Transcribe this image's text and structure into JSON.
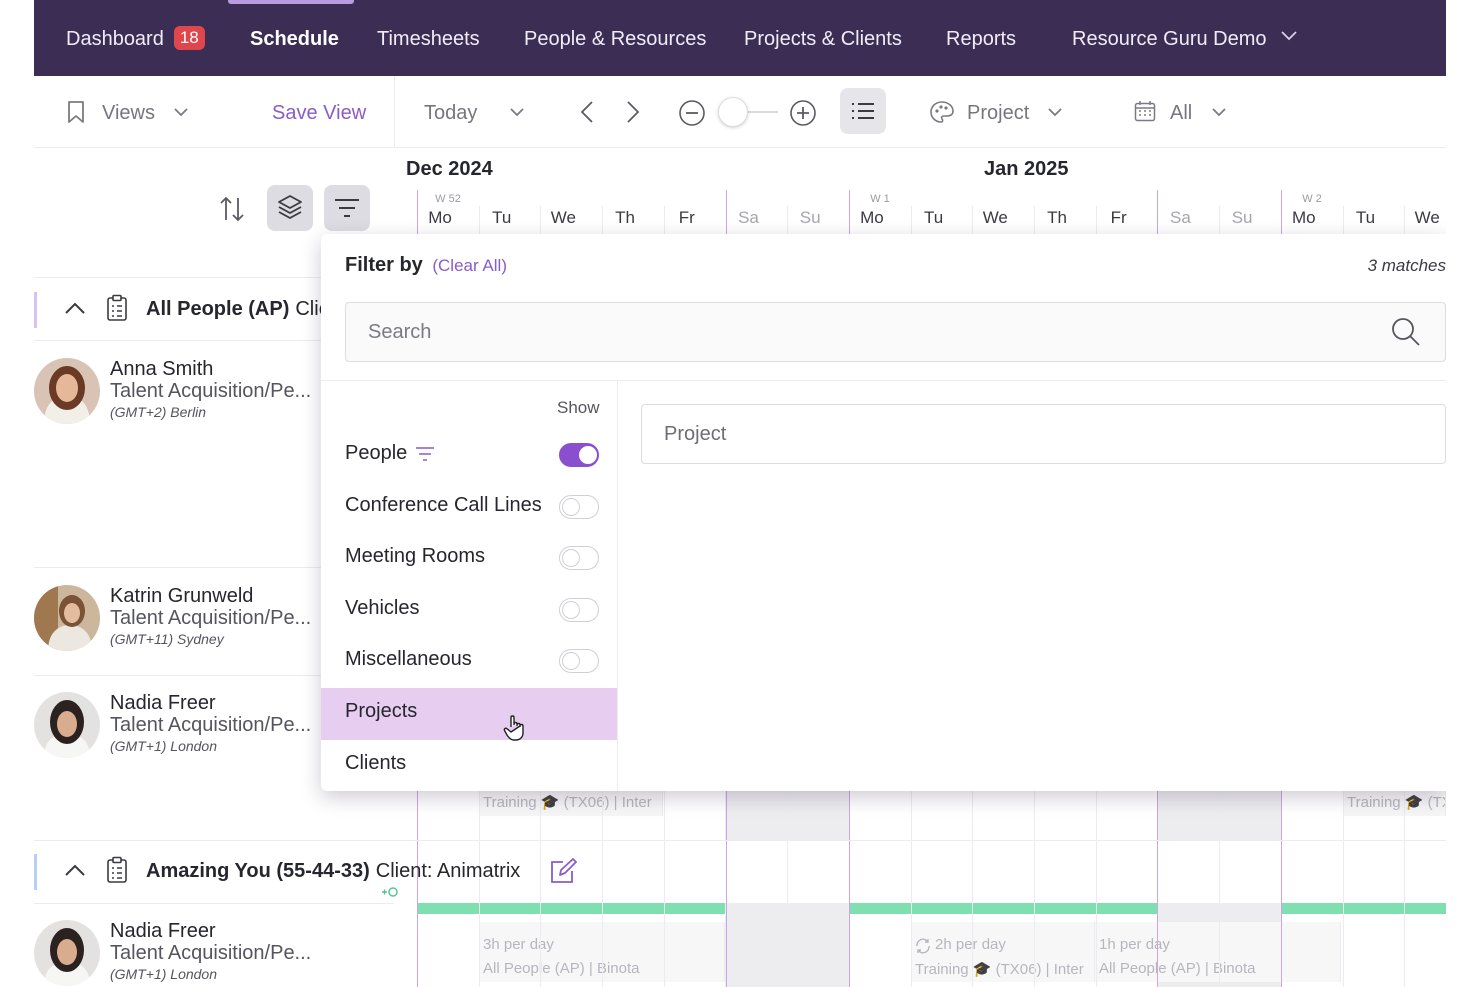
{
  "nav": {
    "items": [
      {
        "label": "Dashboard",
        "badge": "18"
      },
      {
        "label": "Schedule"
      },
      {
        "label": "Timesheets"
      },
      {
        "label": "People & Resources"
      },
      {
        "label": "Projects & Clients"
      },
      {
        "label": "Reports"
      },
      {
        "label": "Resource Guru Demo"
      }
    ],
    "active": "Schedule"
  },
  "toolbar": {
    "views_label": "Views",
    "save_view_label": "Save View",
    "today_label": "Today",
    "color_by_label": "Project",
    "date_filter_label": "All"
  },
  "calendar": {
    "months": [
      "Dec 2024",
      "Jan 2025"
    ],
    "weeks": [
      "W 52",
      "W 1",
      "W 2"
    ],
    "days": [
      "Mo",
      "Tu",
      "We",
      "Th",
      "Fr",
      "Sa",
      "Su",
      "Mo",
      "Tu",
      "We",
      "Th",
      "Fr",
      "Sa",
      "Su",
      "Mo",
      "Tu",
      "We"
    ]
  },
  "groups": [
    {
      "title": "All People (AP)",
      "client": "Clie"
    },
    {
      "title": "Amazing You (55-44-33)",
      "client": "Client: Animatrix"
    }
  ],
  "people": [
    {
      "name": "Anna Smith",
      "role": "Talent Acquisition/Pe...",
      "tz": "(GMT+2) Berlin"
    },
    {
      "name": "Katrin Grunweld",
      "role": "Talent Acquisition/Pe...",
      "tz": "(GMT+11) Sydney"
    },
    {
      "name": "Nadia Freer",
      "role": "Talent Acquisition/Pe...",
      "tz": "(GMT+1) London"
    },
    {
      "name": "Nadia Freer",
      "role": "Talent Acquisition/Pe...",
      "tz": "(GMT+1) London"
    }
  ],
  "bookings": {
    "b1": "Training 🎓 (TX06) | Inter",
    "b2": "Training 🎓 (TX",
    "b3_hours": "3h per day",
    "b3_proj": "All People (AP) | Binota",
    "b4_hours": "2h per day",
    "b4_proj": "Training 🎓 (TX06) | Inter",
    "b5_hours": "1h per day",
    "b5_proj": "All People (AP) | Binota"
  },
  "filter": {
    "title": "Filter by",
    "clear_label": "(Clear All)",
    "matches": "3 matches",
    "search_placeholder": "Search",
    "show_label": "Show",
    "items": [
      {
        "label": "People",
        "toggle": true,
        "on": true
      },
      {
        "label": "Conference Call Lines",
        "toggle": true,
        "on": false
      },
      {
        "label": "Meeting Rooms",
        "toggle": true,
        "on": false
      },
      {
        "label": "Vehicles",
        "toggle": true,
        "on": false
      },
      {
        "label": "Miscellaneous",
        "toggle": true,
        "on": false
      },
      {
        "label": "Projects",
        "toggle": false,
        "highlighted": true
      },
      {
        "label": "Clients",
        "toggle": false
      }
    ],
    "field_value": "Project"
  },
  "colors": {
    "nav_bg": "#3b2d54",
    "accent": "#8a4fcf",
    "badge": "#e0474c",
    "highlight": "#e7cdf0",
    "availability": "#7ee0b0"
  }
}
